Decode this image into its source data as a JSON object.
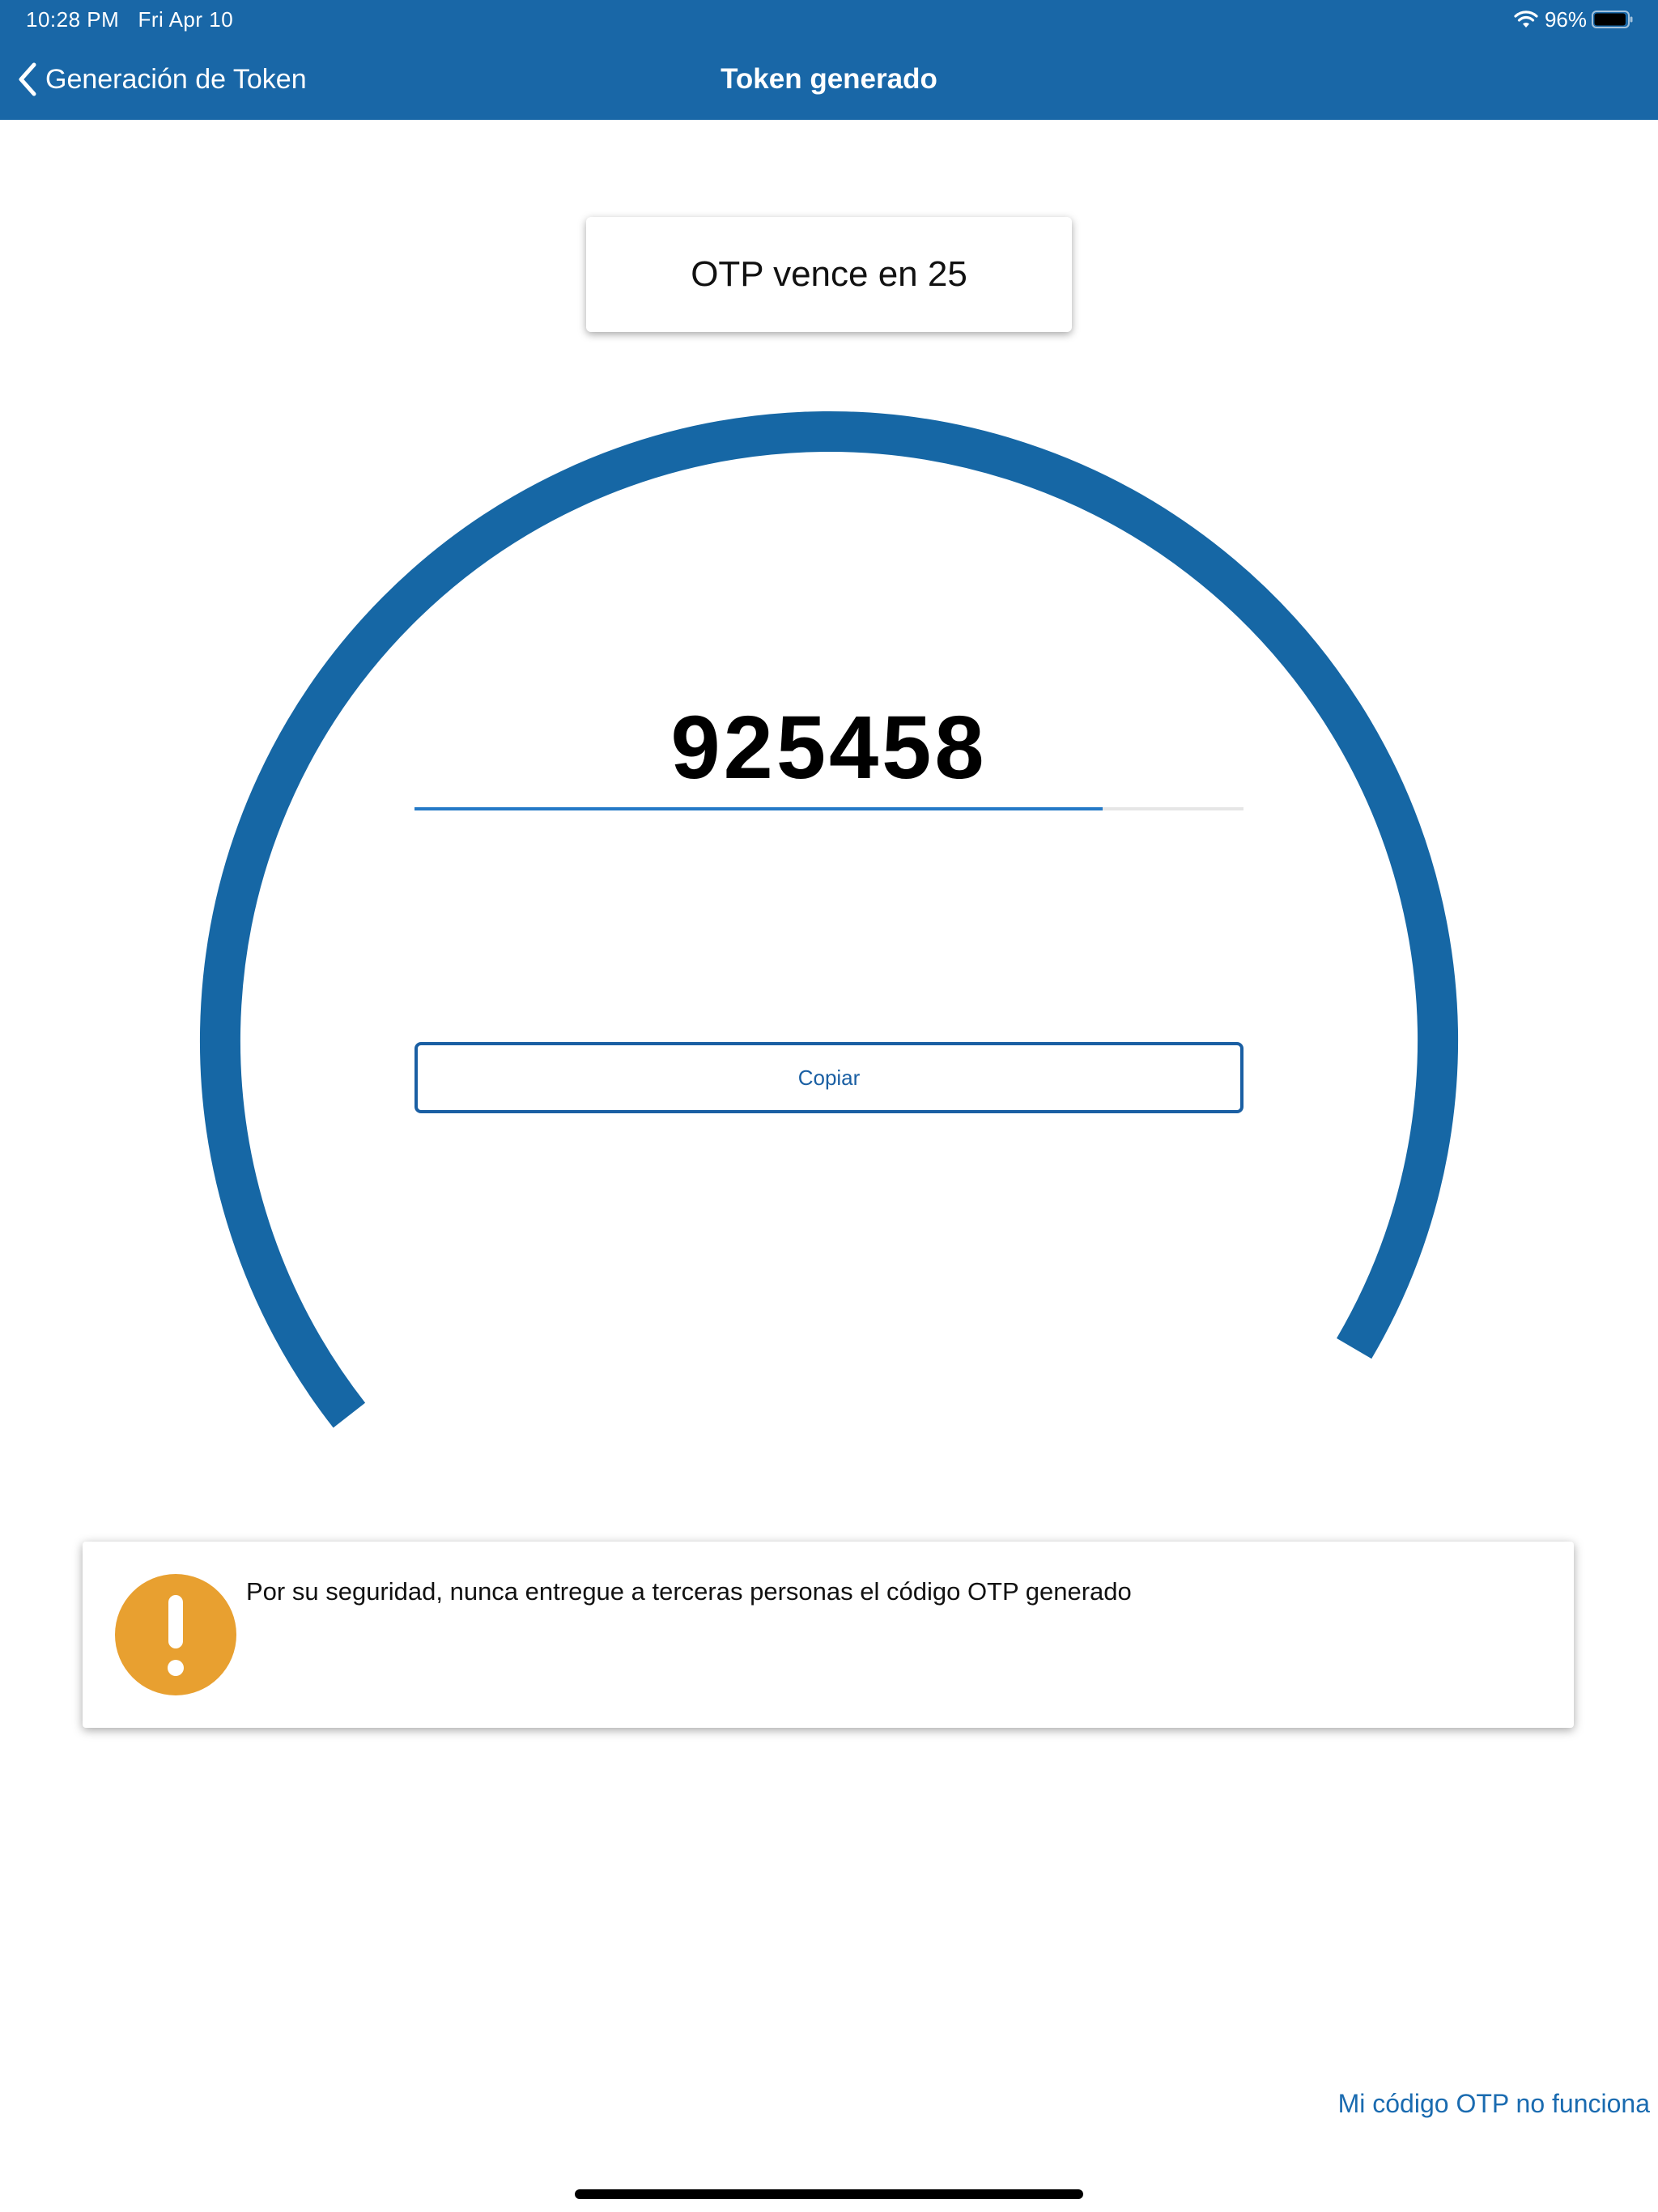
{
  "status_bar": {
    "time": "10:28 PM",
    "date": "Fri Apr 10",
    "battery": "96%",
    "battery_level": 0.96
  },
  "nav": {
    "back_label": "Generación de Token",
    "title": "Token generado"
  },
  "token": {
    "expiry_text": "OTP vence en 25",
    "code": "925458",
    "progress_fraction": 0.83,
    "ring_fraction": 0.69,
    "copy_label": "Copiar"
  },
  "warning": {
    "text": "Por su seguridad, nunca entregue a terceras personas el código OTP generado"
  },
  "footer": {
    "help_link": "Mi código OTP no funciona"
  },
  "colors": {
    "header": "#1967a7",
    "ring": "#1667a5",
    "accent": "#1a5fa3",
    "warning": "#e8a030"
  },
  "icons": {
    "back": "chevron-left-icon",
    "wifi": "wifi-icon",
    "battery": "battery-icon",
    "warning": "exclamation-icon"
  }
}
